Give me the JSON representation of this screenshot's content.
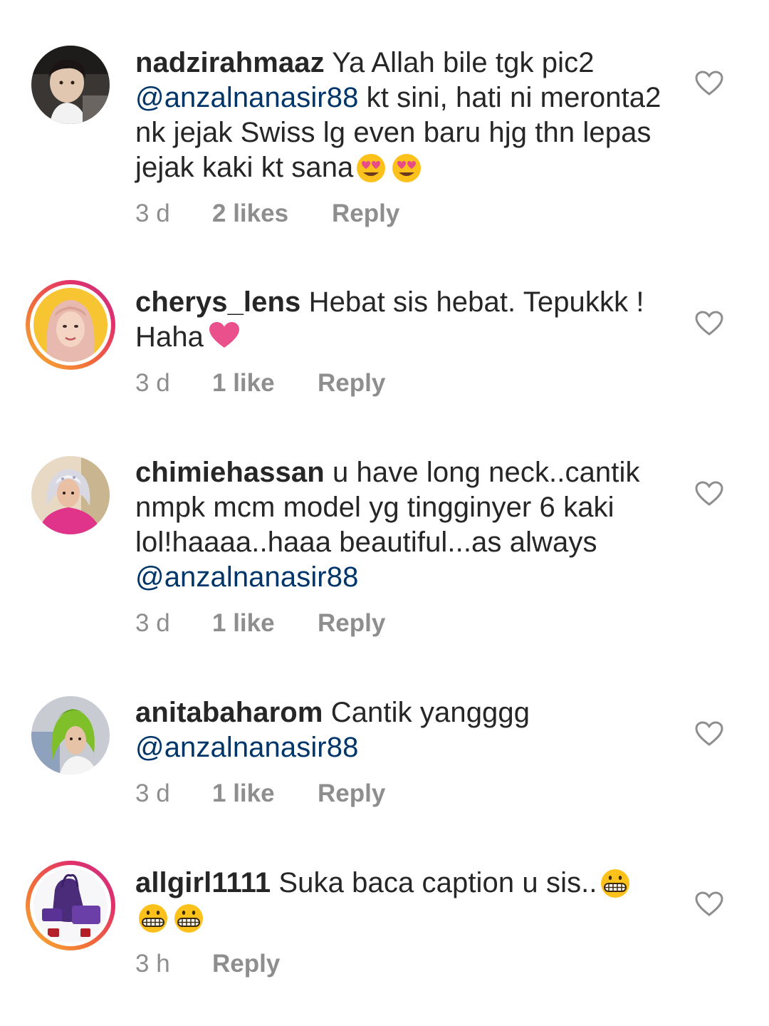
{
  "comments": [
    {
      "username": "nadzirahmaaz",
      "text_1": "Ya Allah bile tgk pic2",
      "mention": "@anzalnanasir88",
      "text_2": "kt sini, hati ni meronta2 nk jejak Swiss lg even baru hjg thn lepas jejak kaki kt sana",
      "emoji": "heart-eyes-emoji",
      "time": "3 d",
      "likes": "2 likes",
      "reply": "Reply",
      "story_ring": false
    },
    {
      "username": "cherys_lens",
      "text_1": "Hebat sis hebat. Tepukkk ! Haha",
      "emoji": "pink-heart-emoji",
      "time": "3 d",
      "likes": "1 like",
      "reply": "Reply",
      "story_ring": true
    },
    {
      "username": "chimiehassan",
      "text_1": "u have long neck..cantik nmpk mcm model yg tingginyer 6 kaki lol!haaaa..haaa beautiful...as always",
      "mention": "@anzalnanasir88",
      "time": "3 d",
      "likes": "1 like",
      "reply": "Reply",
      "story_ring": false
    },
    {
      "username": "anitabaharom",
      "text_1": "Cantik yangggg",
      "mention": "@anzalnanasir88",
      "time": "3 d",
      "likes": "1 like",
      "reply": "Reply",
      "story_ring": false
    },
    {
      "username": "allgirl1111",
      "text_1": "Suka baca caption u sis..",
      "emoji": "grinning-emoji",
      "time": "3 h",
      "reply": "Reply",
      "story_ring": true
    }
  ],
  "colors": {
    "text": "#262626",
    "meta": "#8e8e8e",
    "mention": "#003569",
    "heart_outline": "#8e8e8e",
    "story_ring": "#e1306c"
  }
}
